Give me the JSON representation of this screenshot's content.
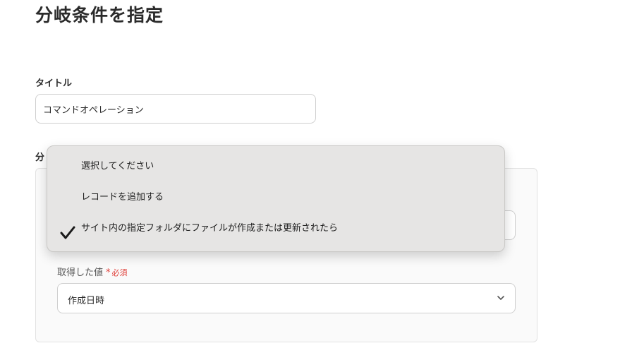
{
  "page": {
    "title": "分岐条件を指定"
  },
  "title_field": {
    "label": "タイトル",
    "value": "コマンドオペレーション"
  },
  "branch_section": {
    "label": "分"
  },
  "dropdown": {
    "items": [
      {
        "label": "選択してください",
        "selected": false
      },
      {
        "label": "レコードを追加する",
        "selected": false
      },
      {
        "label": "サイト内の指定フォルダにファイルが作成または更新されたら",
        "selected": true
      }
    ]
  },
  "value_field": {
    "label": "取得した値",
    "required_mark": "*",
    "required_text": "必須",
    "selected": "作成日時"
  },
  "icons": {
    "check": "check-icon",
    "chevron": "chevron-down-icon"
  },
  "colors": {
    "required": "#e0433d",
    "menu_bg": "#e6e5e4"
  }
}
